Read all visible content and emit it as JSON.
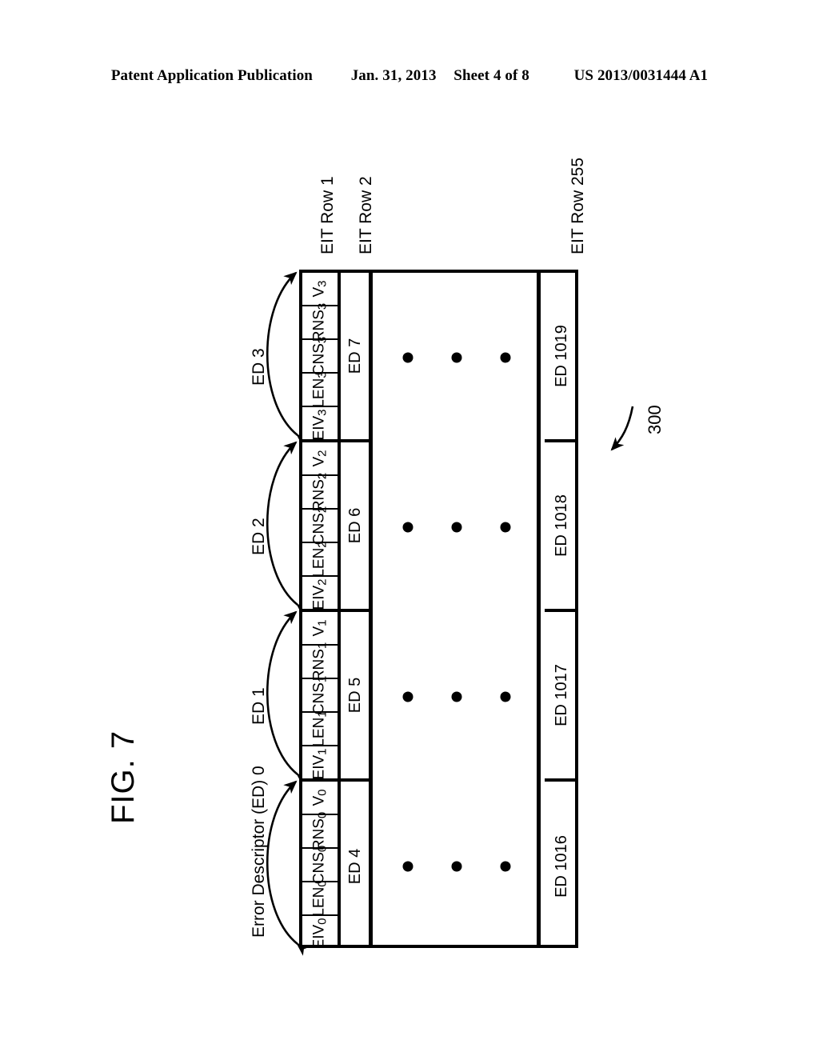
{
  "header": {
    "publication": "Patent Application Publication",
    "date": "Jan. 31, 2013",
    "sheet": "Sheet 4 of 8",
    "docnum": "US 2013/0031444 A1"
  },
  "figure": {
    "label": "FIG. 7",
    "reference_numeral": "300"
  },
  "column_captions": [
    {
      "label": "EIT Row 1"
    },
    {
      "label": "EIT Row 2"
    },
    {
      "label": "EIT Row 255"
    }
  ],
  "ed_brace_labels": [
    {
      "label": "Error Descriptor (ED) 0"
    },
    {
      "label": "ED 1"
    },
    {
      "label": "ED 2"
    },
    {
      "label": "ED 3"
    }
  ],
  "field_names": [
    "EIV",
    "LEN",
    "CNS",
    "RNS",
    "V"
  ],
  "eit_row_1": {
    "groups": [
      {
        "index": "0",
        "fields": [
          {
            "name": "EIV",
            "sub": "0"
          },
          {
            "name": "LEN",
            "sub": "0"
          },
          {
            "name": "CNS",
            "sub": "0"
          },
          {
            "name": "RNS",
            "sub": "0"
          },
          {
            "name": "V",
            "sub": "0"
          }
        ]
      },
      {
        "index": "1",
        "fields": [
          {
            "name": "EIV",
            "sub": "1"
          },
          {
            "name": "LEN",
            "sub": "1"
          },
          {
            "name": "CNS",
            "sub": "1"
          },
          {
            "name": "RNS",
            "sub": "1"
          },
          {
            "name": "V",
            "sub": "1"
          }
        ]
      },
      {
        "index": "2",
        "fields": [
          {
            "name": "EIV",
            "sub": "2"
          },
          {
            "name": "LEN",
            "sub": "2"
          },
          {
            "name": "CNS",
            "sub": "2"
          },
          {
            "name": "RNS",
            "sub": "2"
          },
          {
            "name": "V",
            "sub": "2"
          }
        ]
      },
      {
        "index": "3",
        "fields": [
          {
            "name": "EIV",
            "sub": "3"
          },
          {
            "name": "LEN",
            "sub": "3"
          },
          {
            "name": "CNS",
            "sub": "3"
          },
          {
            "name": "RNS",
            "sub": "3"
          },
          {
            "name": "V",
            "sub": "3"
          }
        ]
      }
    ]
  },
  "eit_row_2": {
    "cells": [
      "ED 4",
      "ED 5",
      "ED 6",
      "ED 7"
    ]
  },
  "eit_row_255": {
    "cells": [
      "ED 1016",
      "ED 1017",
      "ED 1018",
      "ED 1019"
    ]
  },
  "ellipsis": {
    "dot_count_per_row": 3,
    "row_count": 4
  },
  "colors": {
    "line": "#000000",
    "background": "#ffffff"
  }
}
